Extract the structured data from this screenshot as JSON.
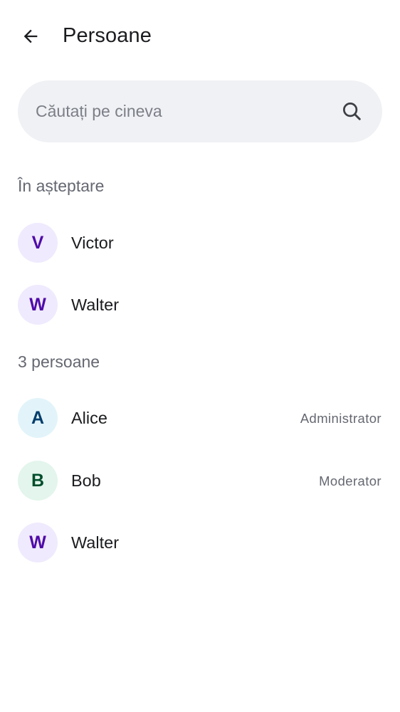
{
  "header": {
    "title": "Persoane"
  },
  "search": {
    "placeholder": "Căutați pe cineva",
    "value": ""
  },
  "pending": {
    "label": "În așteptare",
    "items": [
      {
        "initial": "V",
        "name": "Victor",
        "avatar_bg": "#efeafd",
        "avatar_fg": "#4f0aa8"
      },
      {
        "initial": "W",
        "name": "Walter",
        "avatar_bg": "#efeafd",
        "avatar_fg": "#4f0aa8"
      }
    ]
  },
  "members": {
    "label": "3 persoane",
    "items": [
      {
        "initial": "A",
        "name": "Alice",
        "role": "Administrator",
        "avatar_bg": "#e2f4fa",
        "avatar_fg": "#003d6b"
      },
      {
        "initial": "B",
        "name": "Bob",
        "role": "Moderator",
        "avatar_bg": "#e3f5ec",
        "avatar_fg": "#004d2b"
      },
      {
        "initial": "W",
        "name": "Walter",
        "role": "",
        "avatar_bg": "#efeafd",
        "avatar_fg": "#4f0aa8"
      }
    ]
  },
  "icons": {
    "back": "arrow-back-icon",
    "search": "search-icon"
  }
}
